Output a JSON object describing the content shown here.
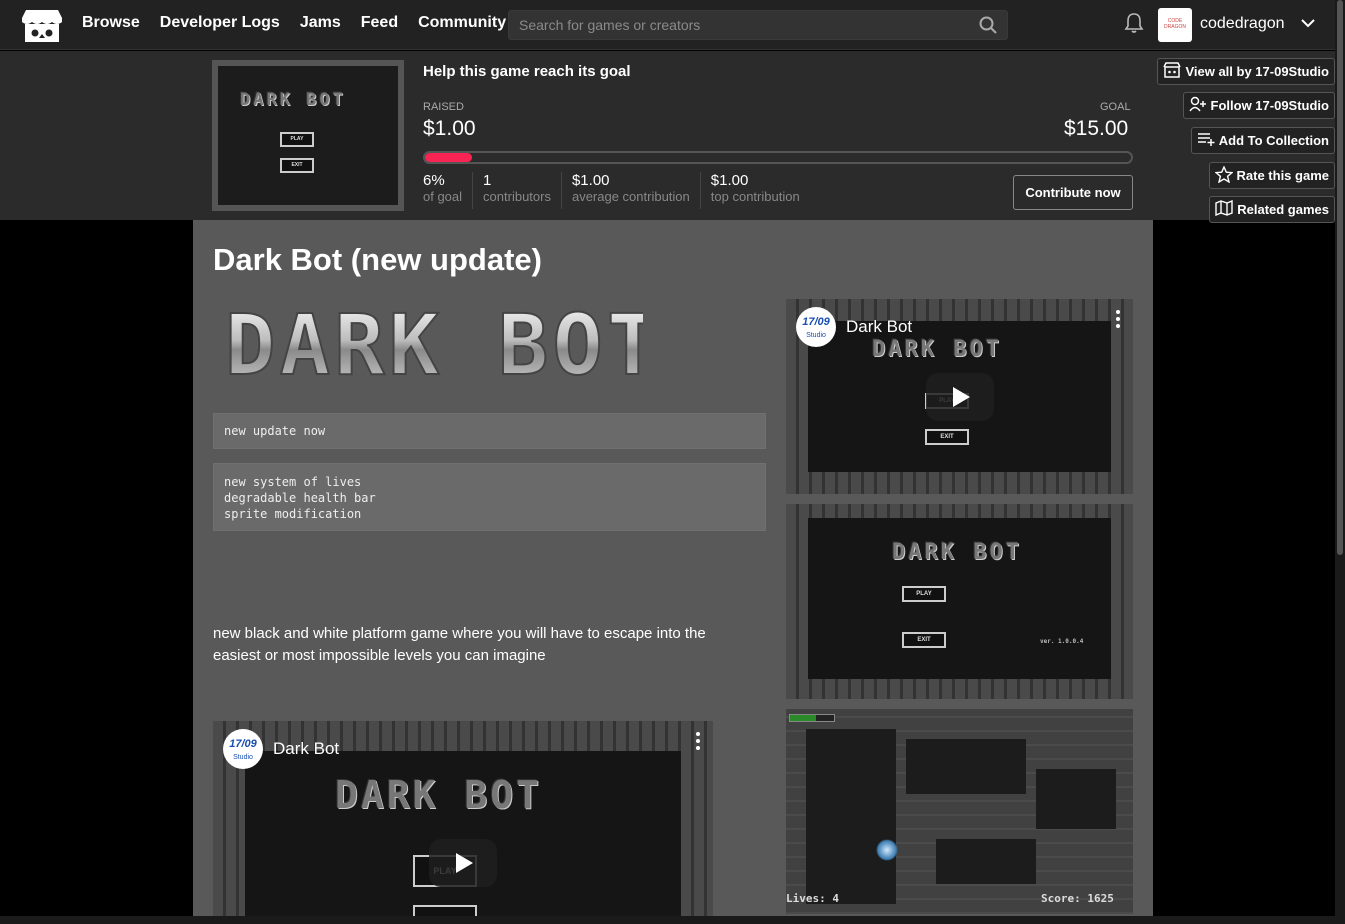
{
  "nav": {
    "links": [
      "Browse",
      "Developer Logs",
      "Jams",
      "Feed",
      "Community"
    ],
    "search_placeholder": "Search for games or creators",
    "username": "codedragon",
    "avatar_text": "CODE DRAGON"
  },
  "funding": {
    "title": "Help this game reach its goal",
    "raised_label": "RAISED",
    "goal_label": "GOAL",
    "raised": "$1.00",
    "goal": "$15.00",
    "progress_fraction": 0.067,
    "stats": [
      {
        "value": "6%",
        "label": "of goal"
      },
      {
        "value": "1",
        "label": "contributors"
      },
      {
        "value": "$1.00",
        "label": "average contribution"
      },
      {
        "value": "$1.00",
        "label": "top contribution"
      }
    ],
    "contribute_label": "Contribute now"
  },
  "side_actions": [
    {
      "label": "View all by 17-09Studio",
      "icon": "store-icon"
    },
    {
      "label": "Follow 17-09Studio",
      "icon": "follow-icon"
    },
    {
      "label": "Add To Collection",
      "icon": "collection-icon"
    },
    {
      "label": "Rate this game",
      "icon": "star-icon"
    },
    {
      "label": "Related games",
      "icon": "map-icon"
    }
  ],
  "game": {
    "title": "Dark Bot (new update)",
    "logo_text": "DARK BOT",
    "update_note": "new update now",
    "changes": [
      "new system of lives",
      "degradable health bar",
      "sprite modification"
    ],
    "description": "new black and white platform game where you will have to escape into the easiest or most impossible levels you can imagine"
  },
  "video": {
    "channel": "17/09",
    "channel_sub": "Studio",
    "title": "Dark Bot",
    "menu_play": "PLAY",
    "menu_exit": "EXIT"
  },
  "screenshot2": {
    "version": "ver. 1.0.0.4"
  },
  "screenshot3": {
    "lives": "Lives: 4",
    "score": "Score: 1625"
  }
}
